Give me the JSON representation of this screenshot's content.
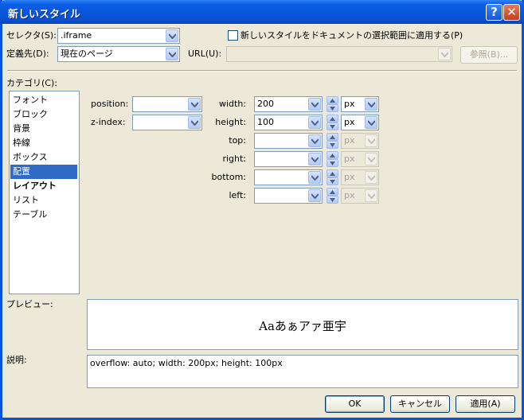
{
  "window": {
    "title": "新しいスタイル"
  },
  "top": {
    "selector_label": "セレクタ(S):",
    "selector_value": ".iframe",
    "apply_checkbox_label": "新しいスタイルをドキュメントの選択範囲に適用する(P)",
    "apply_checkbox_checked": false,
    "define_in_label": "定義先(D):",
    "define_in_value": "現在のページ",
    "url_label": "URL(U):",
    "url_value": "",
    "browse_button": "参照(B)..."
  },
  "category": {
    "label": "カテゴリ(C):",
    "items": [
      "フォント",
      "ブロック",
      "背景",
      "枠線",
      "ボックス",
      "配置",
      "レイアウト",
      "リスト",
      "テーブル"
    ],
    "selected": "配置",
    "bold": "レイアウト"
  },
  "position_fields": {
    "position_label": "position:",
    "position_value": "",
    "z_index_label": "z-index:",
    "z_index_value": "",
    "rows": [
      {
        "label": "width:",
        "value": "200",
        "unit": "px",
        "enabled": true
      },
      {
        "label": "height:",
        "value": "100",
        "unit": "px",
        "enabled": true
      },
      {
        "label": "top:",
        "value": "",
        "unit": "px",
        "enabled": false
      },
      {
        "label": "right:",
        "value": "",
        "unit": "px",
        "enabled": false
      },
      {
        "label": "bottom:",
        "value": "",
        "unit": "px",
        "enabled": false
      },
      {
        "label": "left:",
        "value": "",
        "unit": "px",
        "enabled": false
      }
    ]
  },
  "preview": {
    "label": "プレビュー:",
    "sample_text": "Aaあぁアァ亜宇"
  },
  "description": {
    "label": "説明:",
    "text": "overflow: auto; width: 200px; height: 100px"
  },
  "buttons": {
    "ok": "OK",
    "cancel": "キャンセル",
    "apply": "適用(A)"
  },
  "colors": {
    "titlebar": "#0856dc",
    "selection": "#316ac5",
    "dialog_bg": "#ece9d8"
  }
}
